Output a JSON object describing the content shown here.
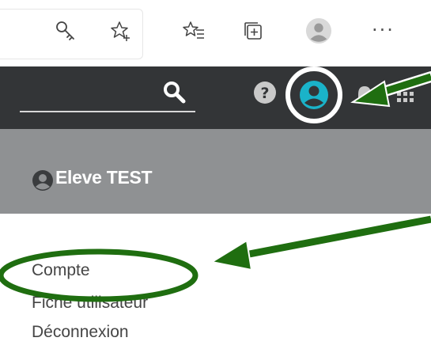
{
  "browser": {
    "toolbar_icons": [
      "key-icon",
      "favorite-star-icon",
      "favorites-list-icon",
      "collections-icon",
      "profile-avatar-icon"
    ],
    "more_label": "···"
  },
  "app_header": {
    "icons": [
      "search-icon",
      "help-icon",
      "user-account-icon",
      "notifications-bell-icon",
      "apps-grid-icon"
    ],
    "accent_color": "#1ab3c9"
  },
  "profile": {
    "name": "Eleve TEST"
  },
  "menu": {
    "items": [
      "Compte",
      "Fiche utilisateur",
      "Déconnexion"
    ]
  },
  "annotation": {
    "arrow_color": "#1f6e10",
    "outline_color": "#ffffff"
  }
}
